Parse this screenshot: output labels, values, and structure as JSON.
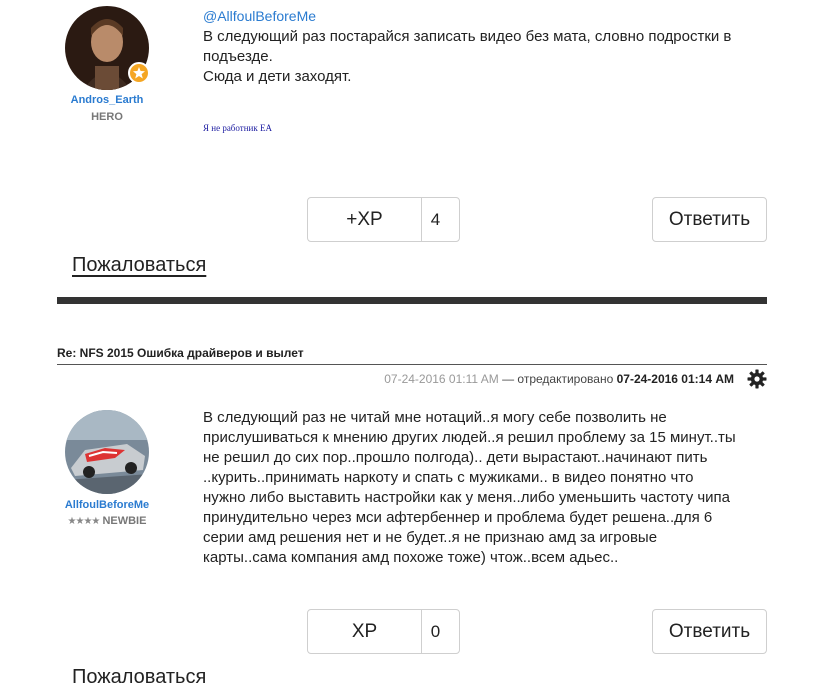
{
  "post1": {
    "username": "Andros_Earth",
    "rank": "HERO",
    "mention": "@AllfoulBeforeMe",
    "body_lines": [
      "В следующий раз постарайся записать видео без мата, словно подростки в",
      "подъезде.",
      "Сюда и дети заходят."
    ],
    "signature": "Я не работник EA",
    "xp_label": "+XP",
    "xp_count": "4",
    "reply_label": "Ответить",
    "report_label": "Пожаловаться"
  },
  "post2": {
    "thread_title": "Re: NFS 2015 Ошибка драйверов и вылет",
    "date_posted": "07-24-2016 01:11 AM",
    "edited_text": "— отредактировано",
    "date_edited": "07-24-2016 01:14 AM",
    "username": "AllfoulBeforeMe",
    "rank_stars": "★★★★",
    "rank": "NEWBIE",
    "body_lines": [
      "В следующий раз не читай мне нотаций..я могу себе позволить не",
      "прислушиваться к мнению других людей..я решил проблему за 15 минут..ты",
      "не решил до сих пор..прошло  полгода).. дети вырастают..начинают пить",
      "..курить..принимать наркоту и спать с мужиками..   в видео понятно что",
      "нужно либо выставить настройки как у меня..либо уменьшить частоту чипа",
      "принудительно через мси афтербеннер и проблема будет решена..для 6",
      "серии амд решения нет и не будет..я не признаю амд за игровые",
      "карты..сама компания амд  похоже тоже) чтож..всем адьес.."
    ],
    "xp_label": "XP",
    "xp_count": "0",
    "reply_label": "Ответить",
    "report_label": "Пожаловаться"
  },
  "icons": {
    "gear": "gear-icon",
    "badge": "rank-badge-icon"
  },
  "colors": {
    "link": "#2a7bd0",
    "signature": "#1a1aa0",
    "badge": "#f5a623"
  }
}
